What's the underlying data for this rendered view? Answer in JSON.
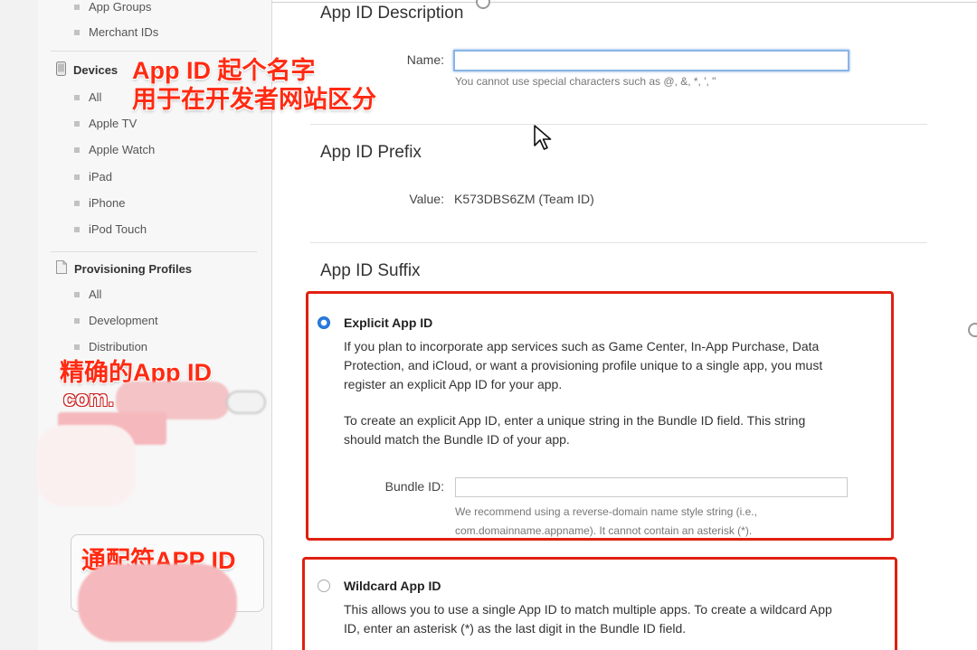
{
  "sidebar": {
    "app_ids_sub": [
      "App Groups",
      "Merchant IDs"
    ],
    "devices": {
      "header": "Devices",
      "items": [
        "All",
        "Apple TV",
        "Apple Watch",
        "iPad",
        "iPhone",
        "iPod Touch"
      ]
    },
    "provisioning": {
      "header": "Provisioning Profiles",
      "items": [
        "All",
        "Development",
        "Distribution"
      ]
    }
  },
  "annotations": {
    "name_hint_line1": "App ID 起个名字",
    "name_hint_line2": "用于在开发者网站区分",
    "explicit_label": "精确的App ID",
    "explicit_example": "com.",
    "wildcard_label": "通配符APP ID"
  },
  "description": {
    "title": "App ID Description",
    "name_label": "Name:",
    "name_value": "",
    "name_hint": "You cannot use special characters such as @, &, *, ', \""
  },
  "prefix": {
    "title": "App ID Prefix",
    "value_label": "Value:",
    "value": "K573DBS6ZM (Team ID)"
  },
  "suffix": {
    "title": "App ID Suffix",
    "explicit": {
      "title": "Explicit App ID",
      "selected": true,
      "para1": [
        "If you plan to incorporate app services such as Game Center, In-App Purchase, Data",
        "Protection, and iCloud, or want a provisioning profile unique to a single app, you must",
        "register an explicit App ID for your app."
      ],
      "para2": [
        "To create an explicit App ID, enter a unique string in the Bundle ID field. This string",
        "should match the Bundle ID of your app."
      ],
      "bundle_label": "Bundle ID:",
      "bundle_value": "",
      "bundle_hint": [
        "We recommend using a reverse-domain name style string (i.e.,",
        "com.domainname.appname). It cannot contain an asterisk (*)."
      ]
    },
    "wildcard": {
      "title": "Wildcard App ID",
      "selected": false,
      "para": [
        "This allows you to use a single App ID to match multiple apps. To create a wildcard App",
        "ID, enter an asterisk (*) as the last digit in the Bundle ID field."
      ]
    }
  },
  "colors": {
    "annotation_red": "#ff2a12",
    "box_red": "#e02010",
    "radio_blue": "#2a7de1",
    "focus_blue": "#8ab4e6"
  }
}
